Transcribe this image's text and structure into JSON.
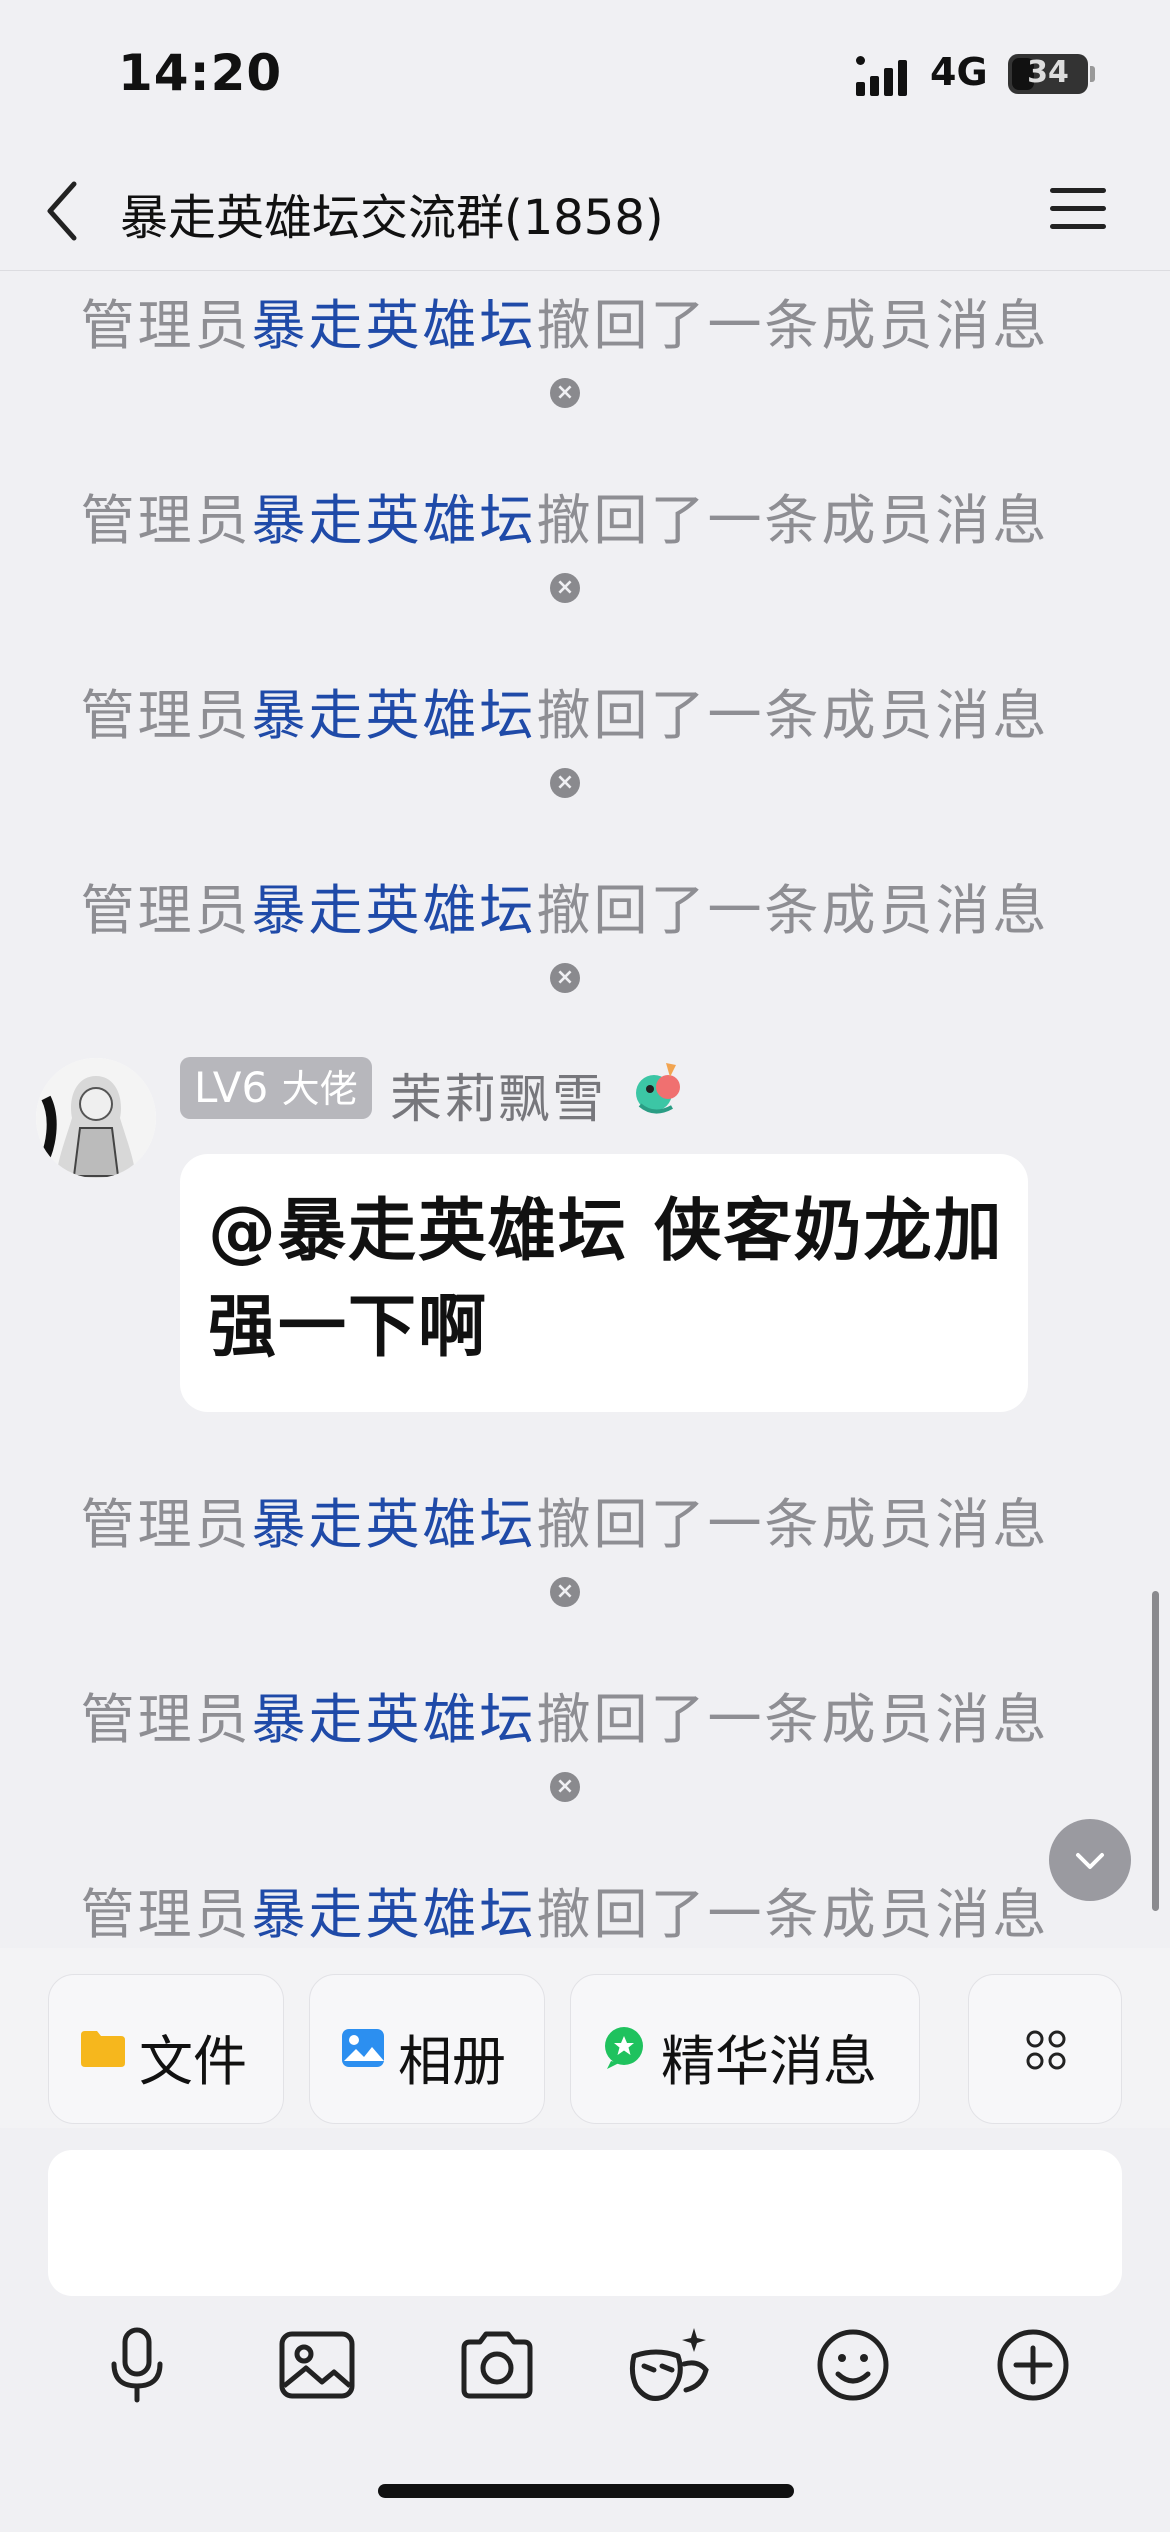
{
  "status": {
    "time": "14:20",
    "network": "4G",
    "battery": "34"
  },
  "nav": {
    "title": "暴走英雄坛交流群(1858)"
  },
  "system_message": {
    "prefix": "管理员",
    "admin": "暴走英雄坛",
    "suffix": "撤回了一条成员消息",
    "close_glyph": "×"
  },
  "message": {
    "level_badge": "LV6",
    "rank": "大佬",
    "sender": "茉莉飘雪",
    "text": "@暴走英雄坛 侠客奶龙加强一下啊"
  },
  "quick_tabs": [
    {
      "label": "文件",
      "icon": "folder-icon"
    },
    {
      "label": "相册",
      "icon": "photo-icon"
    },
    {
      "label": "精华消息",
      "icon": "highlight-icon"
    },
    {
      "label": "",
      "icon": "grid-icon"
    }
  ],
  "toolbar": [
    "microphone-icon",
    "image-icon",
    "camera-icon",
    "mask-icon",
    "emoji-icon",
    "plus-icon"
  ],
  "colors": {
    "admin_link": "#1f4aa8",
    "background": "#f0f0f3",
    "bubble": "#ffffff"
  }
}
